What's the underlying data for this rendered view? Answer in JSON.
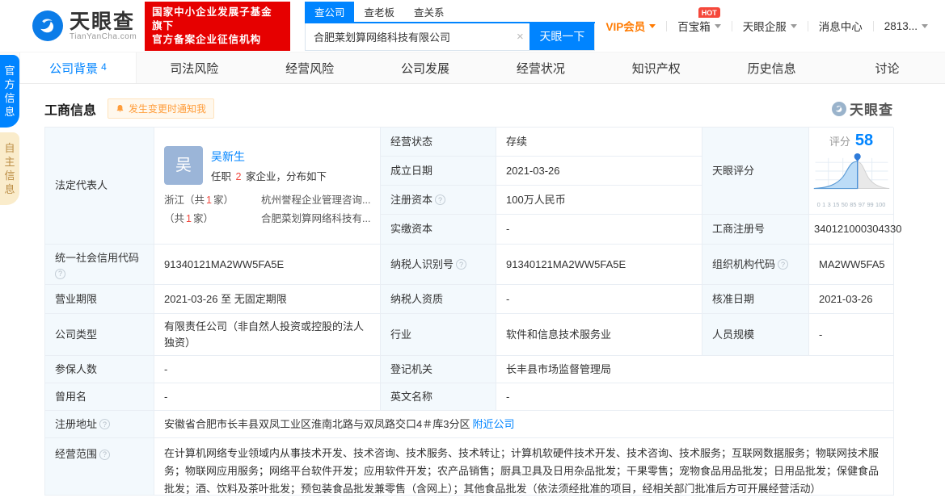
{
  "icons": {
    "help": "?",
    "clear": "×"
  },
  "header": {
    "logo": {
      "brand": "天眼查",
      "domain": "TianYanCha.com",
      "badge_line1": "国家中小企业发展子基金旗下",
      "badge_line2": "官方备案企业征信机构"
    },
    "search": {
      "tabs": [
        {
          "label": "查公司"
        },
        {
          "label": "查老板"
        },
        {
          "label": "查关系"
        }
      ],
      "value": "合肥莱划算网络科技有限公司",
      "button": "天眼一下"
    },
    "menu": {
      "vip": "VIP会员",
      "toolbox": "百宝箱",
      "hot": "HOT",
      "enterprise": "天眼企服",
      "messages": "消息中心",
      "user": "2813..."
    }
  },
  "side_tabs": {
    "official": "官方信息",
    "self": "自主信息"
  },
  "nav_tabs": [
    {
      "label": "公司背景",
      "count": "4"
    },
    {
      "label": "司法风险"
    },
    {
      "label": "经营风险"
    },
    {
      "label": "公司发展"
    },
    {
      "label": "经营状况"
    },
    {
      "label": "知识产权"
    },
    {
      "label": "历史信息"
    },
    {
      "label": "讨论"
    }
  ],
  "section": {
    "title": "工商信息",
    "notify": "发生变更时通知我",
    "watermark": "天眼查"
  },
  "legal_rep": {
    "label": "法定代表人",
    "avatar": "吴",
    "name": "吴新生",
    "tenure_prefix": "任职",
    "tenure_count": "2",
    "tenure_suffix": "家企业，分布如下",
    "rows": [
      {
        "region_pre": "浙江（共",
        "region_count": "1",
        "region_post": "家）",
        "company": "杭州誉程企业管理咨询..."
      },
      {
        "region_pre": "（共",
        "region_count": "1",
        "region_post": "家）",
        "company": "合肥菜划算网络科技有..."
      }
    ]
  },
  "score": {
    "label": "天眼评分",
    "caption": "评分",
    "value": "58",
    "axis": [
      "0",
      "1",
      "3",
      "15",
      "50",
      "85",
      "97",
      "99",
      "100"
    ]
  },
  "fields": {
    "status": {
      "label": "经营状态",
      "value": "存续"
    },
    "est_date": {
      "label": "成立日期",
      "value": "2021-03-26"
    },
    "reg_capital": {
      "label": "注册资本",
      "value": "100万人民币"
    },
    "paid_capital": {
      "label": "实缴资本",
      "value": "-"
    },
    "reg_number": {
      "label": "工商注册号",
      "value": "340121000304330"
    },
    "credit_code": {
      "label": "统一社会信用代码",
      "value": "91340121MA2WW5FA5E"
    },
    "taxpayer_id": {
      "label": "纳税人识别号",
      "value": "91340121MA2WW5FA5E"
    },
    "org_code": {
      "label": "组织机构代码",
      "value": "MA2WW5FA5"
    },
    "business_term": {
      "label": "营业期限",
      "value": "2021-03-26 至 无固定期限"
    },
    "taxpayer_quality": {
      "label": "纳税人资质",
      "value": "-"
    },
    "approval_date": {
      "label": "核准日期",
      "value": "2021-03-26"
    },
    "company_type": {
      "label": "公司类型",
      "value": "有限责任公司（非自然人投资或控股的法人独资）"
    },
    "industry": {
      "label": "行业",
      "value": "软件和信息技术服务业"
    },
    "staff_size": {
      "label": "人员规模",
      "value": "-"
    },
    "insured_count": {
      "label": "参保人数",
      "value": "-"
    },
    "reg_authority": {
      "label": "登记机关",
      "value": "长丰县市场监督管理局"
    },
    "former_name": {
      "label": "曾用名",
      "value": "-"
    },
    "english_name": {
      "label": "英文名称",
      "value": "-"
    },
    "reg_address": {
      "label": "注册地址",
      "value": "安徽省合肥市长丰县双凤工业区淮南北路与双凤路交口4＃库3分区",
      "link": "附近公司"
    },
    "business_scope": {
      "label": "经营范围",
      "value": "在计算机网络专业领域内从事技术开发、技术咨询、技术服务、技术转让；计算机软硬件技术开发、技术咨询、技术服务；互联网数据服务；物联网技术服务；物联网应用服务；网络平台软件开发；应用软件开发；农产品销售；厨具卫具及日用杂品批发；干果零售；宠物食品用品批发；日用品批发；保健食品批发；酒、饮料及茶叶批发；预包装食品批发兼零售（含网上）；其他食品批发（依法须经批准的项目，经相关部门批准后方可开展经营活动）"
    }
  }
}
